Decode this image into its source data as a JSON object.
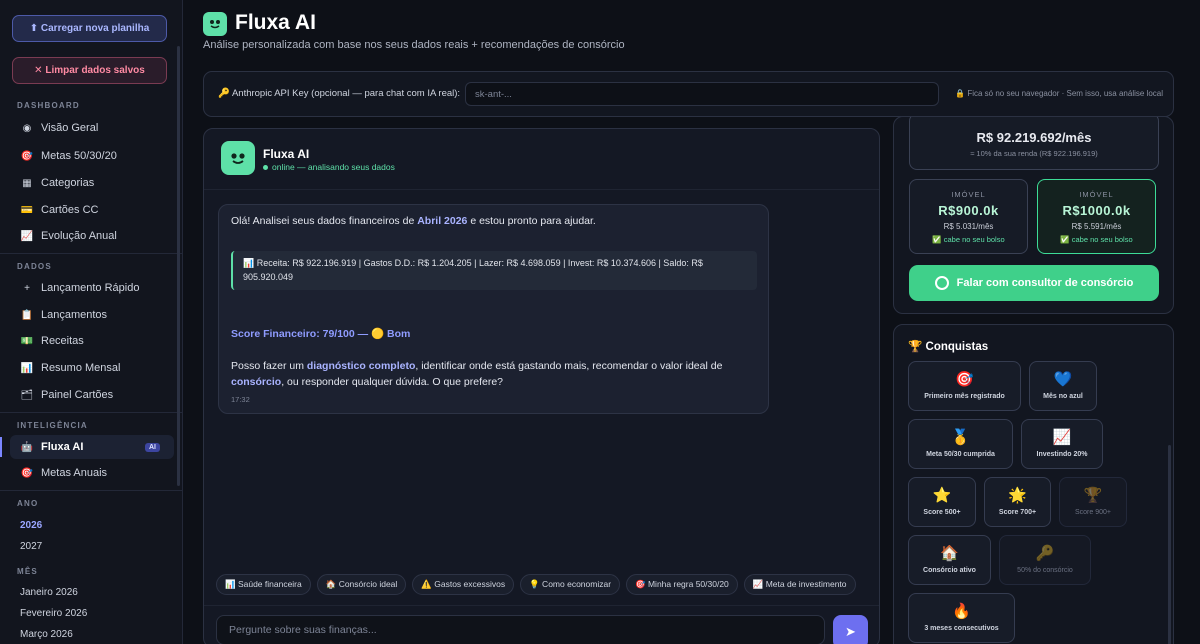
{
  "sidebar": {
    "upload_label": "⬆ Carregar nova planilha",
    "clear_label": "✕ Limpar dados salvos",
    "dashboard_title": "DASHBOARD",
    "dashboard_items": [
      {
        "label": "Visão Geral",
        "icon": "◉"
      },
      {
        "label": "Metas 50/30/20",
        "icon": "🎯"
      },
      {
        "label": "Categorias",
        "icon": "▦"
      },
      {
        "label": "Cartões CC",
        "icon": "💳"
      },
      {
        "label": "Evolução Anual",
        "icon": "📈"
      }
    ],
    "dados_title": "DADOS",
    "dados_items": [
      {
        "label": "Lançamento Rápido",
        "icon": "+"
      },
      {
        "label": "Lançamentos",
        "icon": "📋"
      },
      {
        "label": "Receitas",
        "icon": "💵"
      },
      {
        "label": "Resumo Mensal",
        "icon": "📊"
      },
      {
        "label": "Painel Cartões",
        "icon": "🗂"
      }
    ],
    "ia_title": "INTELIGÊNCIA",
    "ia_items": [
      {
        "label": "Fluxa AI",
        "icon": "🤖",
        "badge": "AI"
      },
      {
        "label": "Metas Anuais",
        "icon": "🎯"
      }
    ],
    "ano_title": "ANO",
    "anos": [
      "2026",
      "2027"
    ],
    "mes_title": "MÊS",
    "meses": [
      "Janeiro 2026",
      "Fevereiro 2026",
      "Março 2026"
    ]
  },
  "header": {
    "title": "Fluxa AI",
    "subtitle": "Análise personalizada com base nos seus dados reais + recomendações de consórcio"
  },
  "api": {
    "label": "🔑 Anthropic API Key (opcional — para chat com IA real):",
    "placeholder": "sk-ant-...",
    "note": "🔒 Fica só no seu navegador · Sem isso, usa análise local"
  },
  "chat": {
    "bot_name": "Fluxa AI",
    "status": "online — analisando seus dados",
    "msg_intro_a": "Olá! Analisei seus dados financeiros de ",
    "msg_intro_month": "Abril 2026",
    "msg_intro_b": " e estou pronto para ajudar.",
    "data_line": "📊 Receita: R$ 922.196.919 | Gastos D.D.: R$ 1.204.205 | Lazer: R$ 4.698.059 | Invest: R$ 10.374.606 | Saldo: R$ 905.920.049",
    "score_line": "Score Financeiro: 79/100 — 🟡 Bom",
    "msg_end_a": "Posso fazer um ",
    "msg_end_hl1": "diagnóstico completo",
    "msg_end_b": ", identificar onde está gastando mais, recomendar o valor ideal de ",
    "msg_end_hl2": "consórcio",
    "msg_end_c": ", ou responder qualquer dúvida. O que prefere?",
    "time": "17:32",
    "chips": [
      "📊 Saúde financeira",
      "🏠 Consórcio ideal",
      "⚠️ Gastos excessivos",
      "💡 Como economizar",
      "🎯 Minha regra 50/30/20",
      "📈 Meta de investimento"
    ],
    "input_placeholder": "Pergunte sobre suas finanças...",
    "send_icon": "➤"
  },
  "consorcio": {
    "rec_value": "R$ 92.219.692/mês",
    "rec_note": "≈ 10% da sua renda (R$ 922.196.919)",
    "options": [
      {
        "type": "IMÓVEL",
        "value": "R$900.0k",
        "monthly": "R$ 5.031/mês",
        "fit": "✅ cabe no seu bolso"
      },
      {
        "type": "IMÓVEL",
        "value": "R$1000.0k",
        "monthly": "R$ 5.591/mês",
        "fit": "✅ cabe no seu bolso"
      }
    ],
    "whatsapp_label": "Falar com consultor de consórcio"
  },
  "conquistas": {
    "title": "🏆 Conquistas",
    "items": [
      {
        "icon": "🎯",
        "label": "Primeiro mês registrado"
      },
      {
        "icon": "💙",
        "label": "Mês no azul"
      },
      {
        "icon": "🥇",
        "label": "Meta 50/30 cumprida"
      },
      {
        "icon": "📈",
        "label": "Investindo 20%"
      },
      {
        "icon": "⭐",
        "label": "Score 500+"
      },
      {
        "icon": "🌟",
        "label": "Score 700+"
      },
      {
        "icon": "🏆",
        "label": "Score 900+"
      },
      {
        "icon": "🏠",
        "label": "Consórcio ativo"
      },
      {
        "icon": "🔑",
        "label": "50% do consórcio"
      },
      {
        "icon": "🔥",
        "label": "3 meses consecutivos"
      }
    ]
  }
}
